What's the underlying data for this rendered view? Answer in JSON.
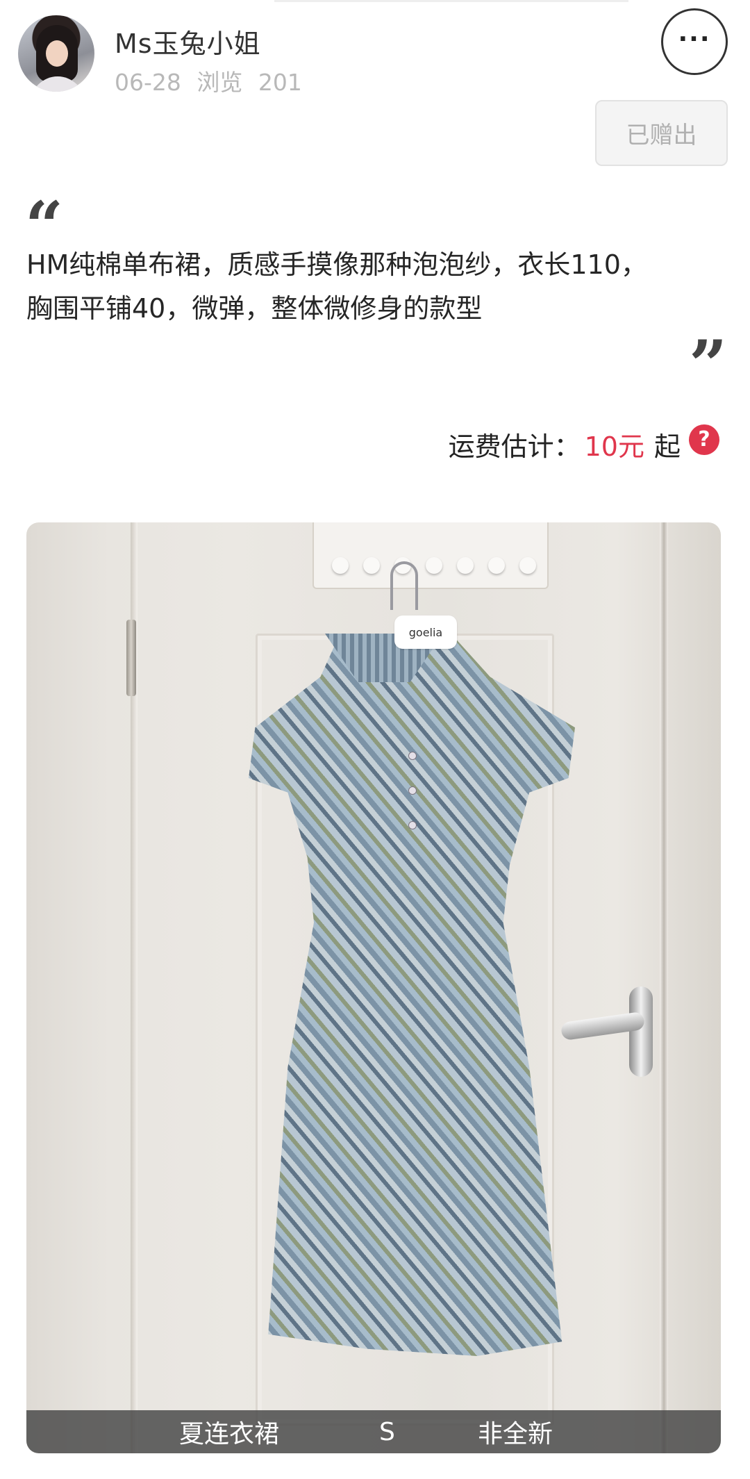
{
  "header": {
    "username": "Ms玉兔小姐",
    "date": "06-28",
    "views_label": "浏览",
    "views_count": "201",
    "more_label": "···",
    "status_badge": "已赠出"
  },
  "post": {
    "description": "HM纯棉单布裙，质感手摸像那种泡泡纱，衣长110，\n胸围平铺40，微弹，整体微修身的款型",
    "quote_open": "“",
    "quote_close": "”"
  },
  "shipping": {
    "label": "运费估计：",
    "fee": "10元",
    "suffix": "起",
    "help_icon": "question-circle-icon",
    "help_symbol": "?"
  },
  "photo": {
    "hanger_brand": "goelia",
    "tags": [
      "夏连衣裙",
      "S",
      "非全新"
    ]
  },
  "colors": {
    "accent_red": "#e0364c",
    "muted_text": "#b8b8b8"
  }
}
